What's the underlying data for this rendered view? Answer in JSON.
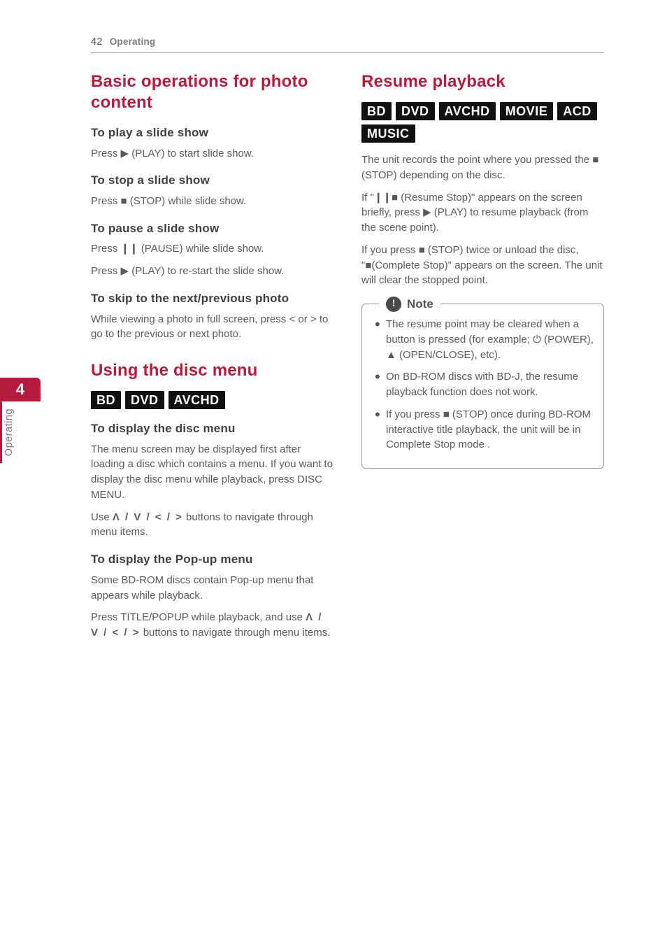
{
  "page": {
    "number": "42",
    "section": "Operating"
  },
  "sidetab": {
    "num": "4",
    "label": "Operating"
  },
  "left": {
    "h_basic": "Basic operations for photo content",
    "h_play": "To play a slide show",
    "p_play": "Press ▶ (PLAY) to start slide show.",
    "h_stop": "To stop a slide show",
    "p_stop": "Press ■ (STOP) while slide show.",
    "h_pause": "To pause a slide show",
    "p_pause1": "Press ❙❙ (PAUSE) while slide show.",
    "p_pause2": "Press ▶ (PLAY) to re-start the slide show.",
    "h_skip": "To skip to the next/previous photo",
    "p_skip": "While viewing a photo in full screen, press < or > to go to the previous or next photo.",
    "h_discmenu": "Using the disc menu",
    "badges_disc": [
      "BD",
      "DVD",
      "AVCHD"
    ],
    "h_dispdisc": "To display the disc menu",
    "p_dispdisc1": "The menu screen may be displayed first after loading a disc which contains a menu. If you want to display the disc menu while playback, press DISC MENU.",
    "p_dispdisc2_a": "Use ",
    "p_dispdisc2_nav": "Λ / V / < / >",
    "p_dispdisc2_b": " buttons to navigate through menu items.",
    "h_popup": "To display the Pop-up menu",
    "p_popup1": "Some BD-ROM discs contain Pop-up menu that appears while playback.",
    "p_popup2_a": "Press TITLE/POPUP while playback, and use ",
    "p_popup2_nav": "Λ / V / < / >",
    "p_popup2_b": " buttons to navigate through menu items."
  },
  "right": {
    "h_resume": "Resume playback",
    "badges_resume": [
      "BD",
      "DVD",
      "AVCHD",
      "MOVIE",
      "ACD",
      "MUSIC"
    ],
    "p1": "The unit records the point where you pressed the ■ (STOP) depending on the disc.",
    "p2": "If \"❙❙■ (Resume Stop)\" appears on the screen briefly, press ▶ (PLAY) to resume playback (from the scene point).",
    "p3": "If you press ■ (STOP) twice or unload the disc, \"■(Complete Stop)\" appears on the screen. The unit will clear the stopped point.",
    "note_label": "Note",
    "note_items": [
      "The resume point may be cleared when a button is pressed (for example; ⏻ (POWER), ▲ (OPEN/CLOSE), etc).",
      "On BD-ROM discs with BD-J, the resume playback function does not work.",
      "If you press ■ (STOP) once during BD-ROM interactive title playback, the unit will be in Complete Stop mode ."
    ]
  }
}
